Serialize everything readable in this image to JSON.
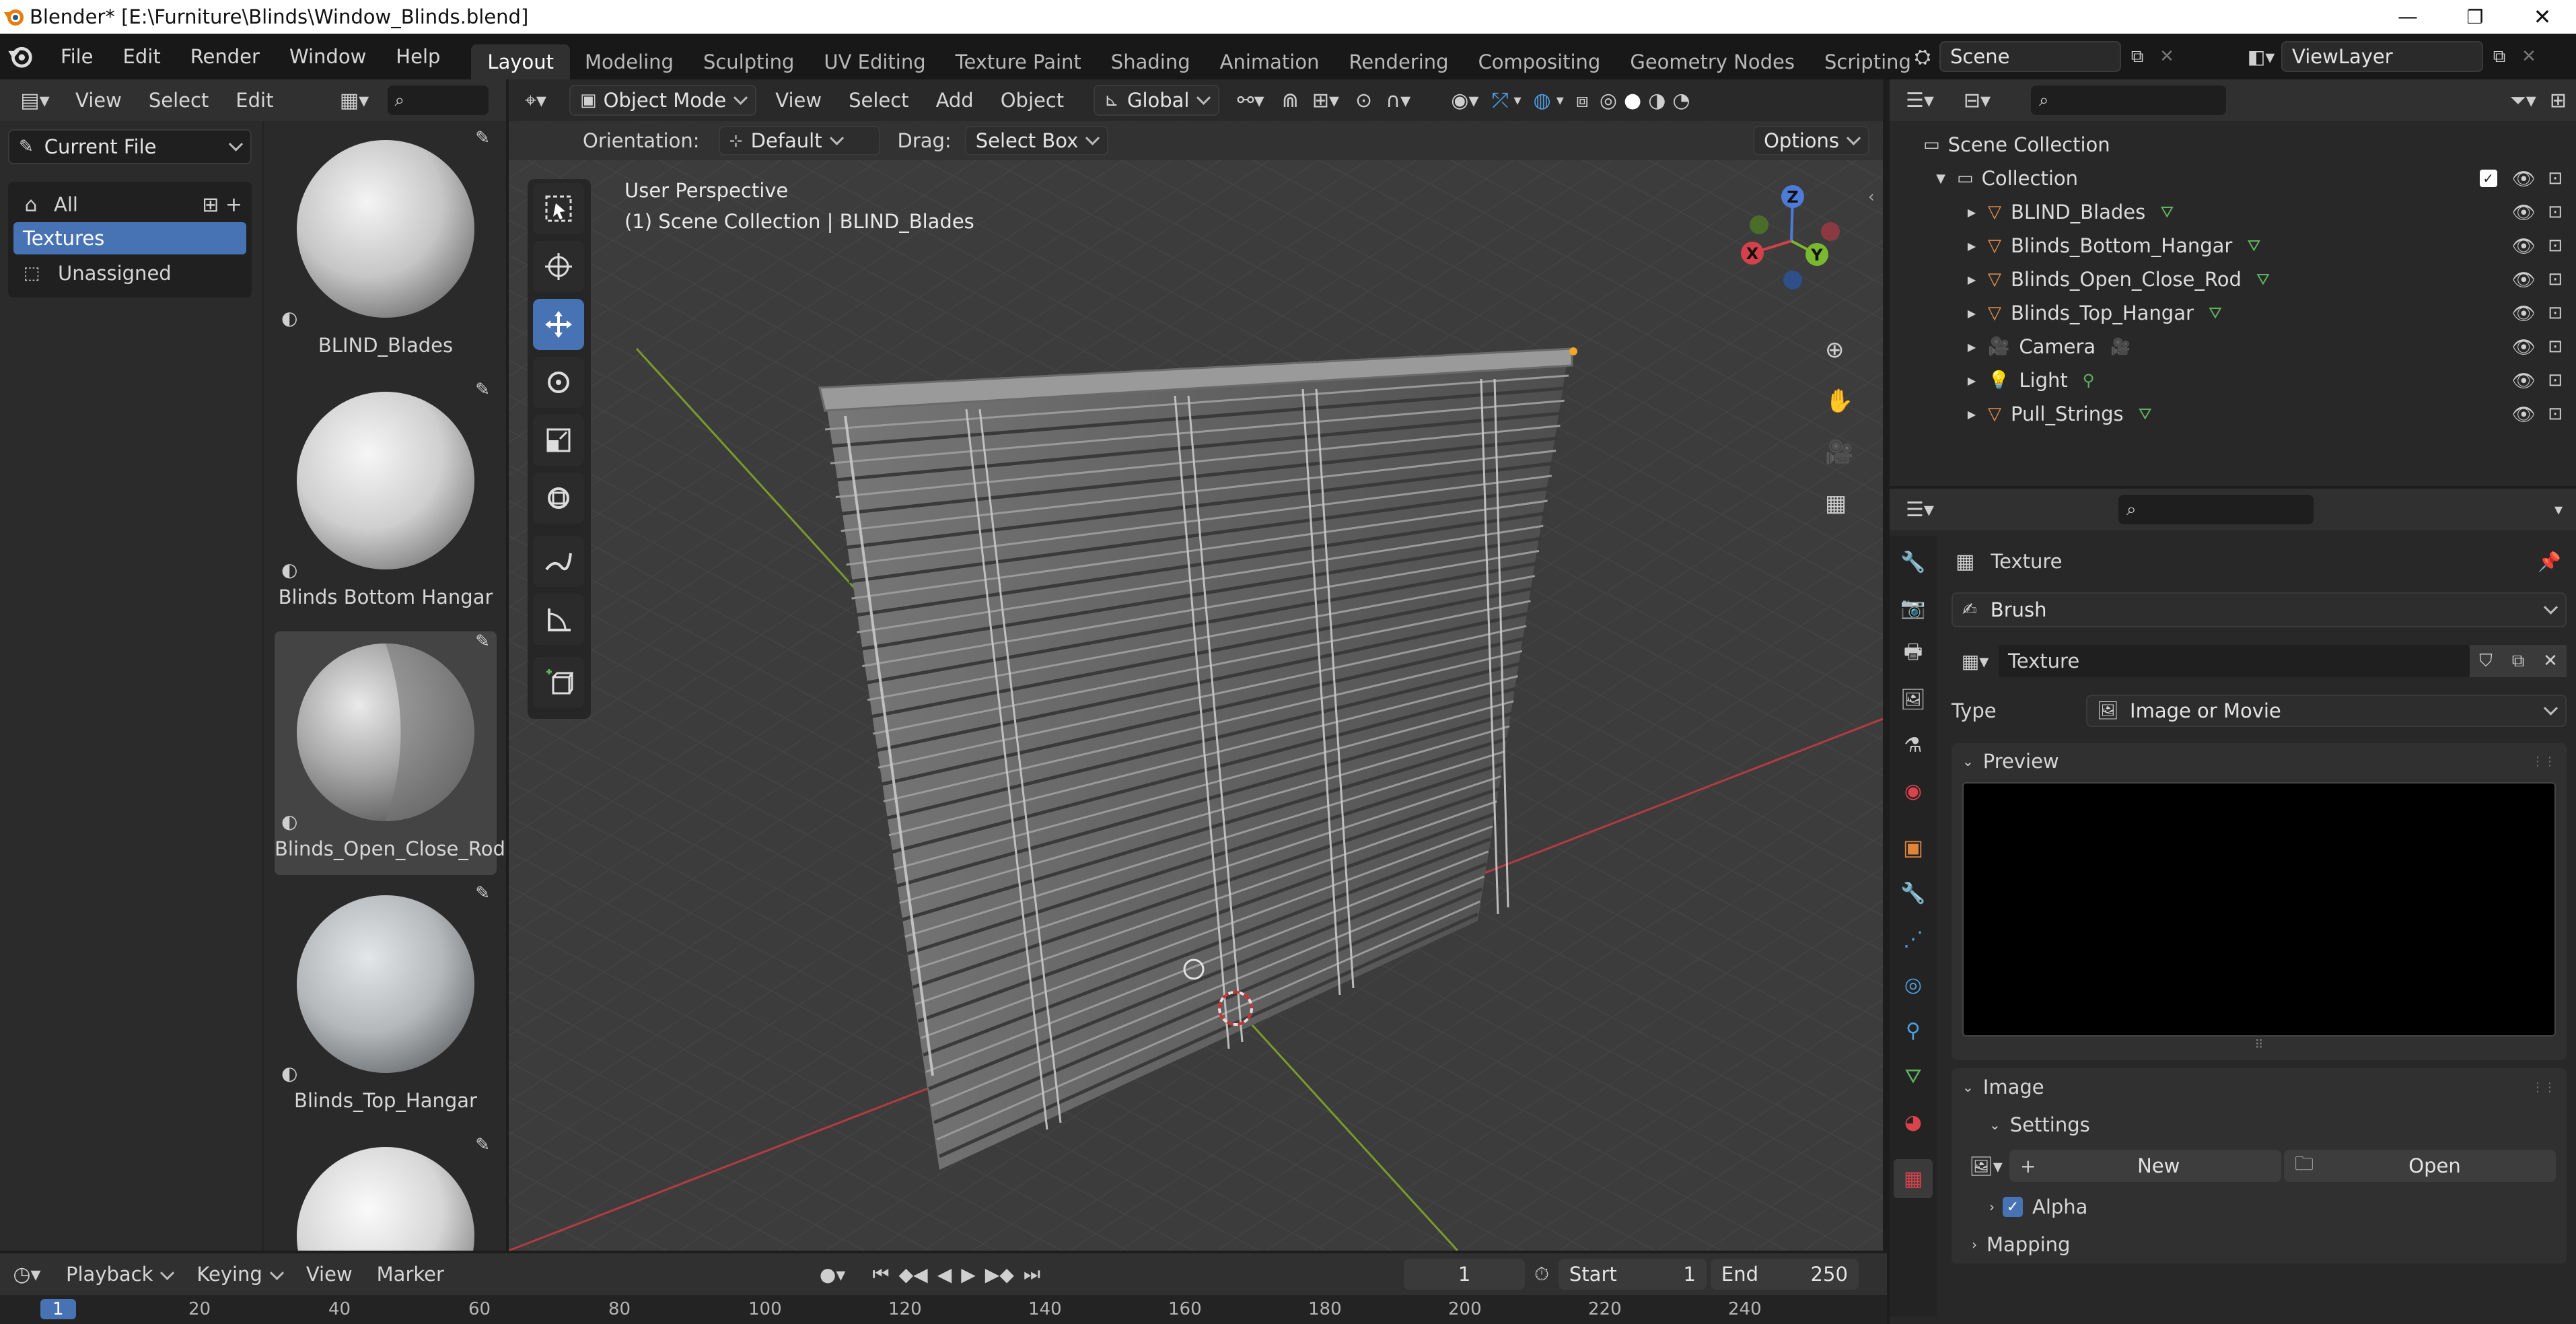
{
  "window": {
    "title": "Blender* [E:\\Furniture\\Blinds\\Window_Blinds.blend]"
  },
  "menu": {
    "items": [
      "File",
      "Edit",
      "Render",
      "Window",
      "Help"
    ]
  },
  "workspaces": [
    "Layout",
    "Modeling",
    "Sculpting",
    "UV Editing",
    "Texture Paint",
    "Shading",
    "Animation",
    "Rendering",
    "Compositing",
    "Geometry Nodes",
    "Scripting"
  ],
  "active_workspace": "Layout",
  "scene": {
    "scene_name": "Scene",
    "view_layer": "ViewLayer"
  },
  "asset_browser": {
    "header_menus": [
      "View",
      "Select",
      "Edit"
    ],
    "library": "Current File",
    "catalogs": [
      "All",
      "Textures",
      "Unassigned"
    ],
    "assets": [
      "BLIND_Blades",
      "Blinds Bottom Hangar",
      "Blinds_Open_Close_Rod",
      "Blinds_Top_Hangar"
    ]
  },
  "viewport": {
    "mode": "Object Mode",
    "menus": [
      "View",
      "Select",
      "Add",
      "Object"
    ],
    "transform_orientation": "Global",
    "orientation_label": "Orientation:",
    "orientation_value": "Default",
    "drag_label": "Drag:",
    "drag_value": "Select Box",
    "options_label": "Options",
    "view_name": "User Perspective",
    "view_context": "(1) Scene Collection | BLIND_Blades",
    "gizmo": {
      "x": "X",
      "y": "Y",
      "z": "Z"
    }
  },
  "outliner": {
    "root": "Scene Collection",
    "collection": "Collection",
    "objects": [
      {
        "name": "BLIND_Blades",
        "type": "mesh"
      },
      {
        "name": "Blinds_Bottom_Hangar",
        "type": "mesh"
      },
      {
        "name": "Blinds_Open_Close_Rod",
        "type": "mesh"
      },
      {
        "name": "Blinds_Top_Hangar",
        "type": "mesh"
      },
      {
        "name": "Camera",
        "type": "camera"
      },
      {
        "name": "Light",
        "type": "light"
      },
      {
        "name": "Pull_Strings",
        "type": "mesh"
      }
    ]
  },
  "properties": {
    "header_title": "Texture",
    "brush_label": "Brush",
    "texture_name": "Texture",
    "type_label": "Type",
    "type_value": "Image or Movie",
    "preview_label": "Preview",
    "image_label": "Image",
    "settings_label": "Settings",
    "new_label": "New",
    "open_label": "Open",
    "alpha_label": "Alpha",
    "mapping_label": "Mapping"
  },
  "timeline": {
    "menus": [
      "Playback",
      "Keying",
      "View",
      "Marker"
    ],
    "current_frame": "1",
    "start_label": "Start",
    "start_value": "1",
    "end_label": "End",
    "end_value": "250",
    "ruler": [
      "1",
      "20",
      "40",
      "60",
      "80",
      "100",
      "120",
      "140",
      "160",
      "180",
      "200",
      "220",
      "240"
    ]
  },
  "colors": {
    "accent": "#4772b3",
    "mesh_icon": "#e09050",
    "data_green": "#5fb35f",
    "object_orange": "#e0853a"
  }
}
